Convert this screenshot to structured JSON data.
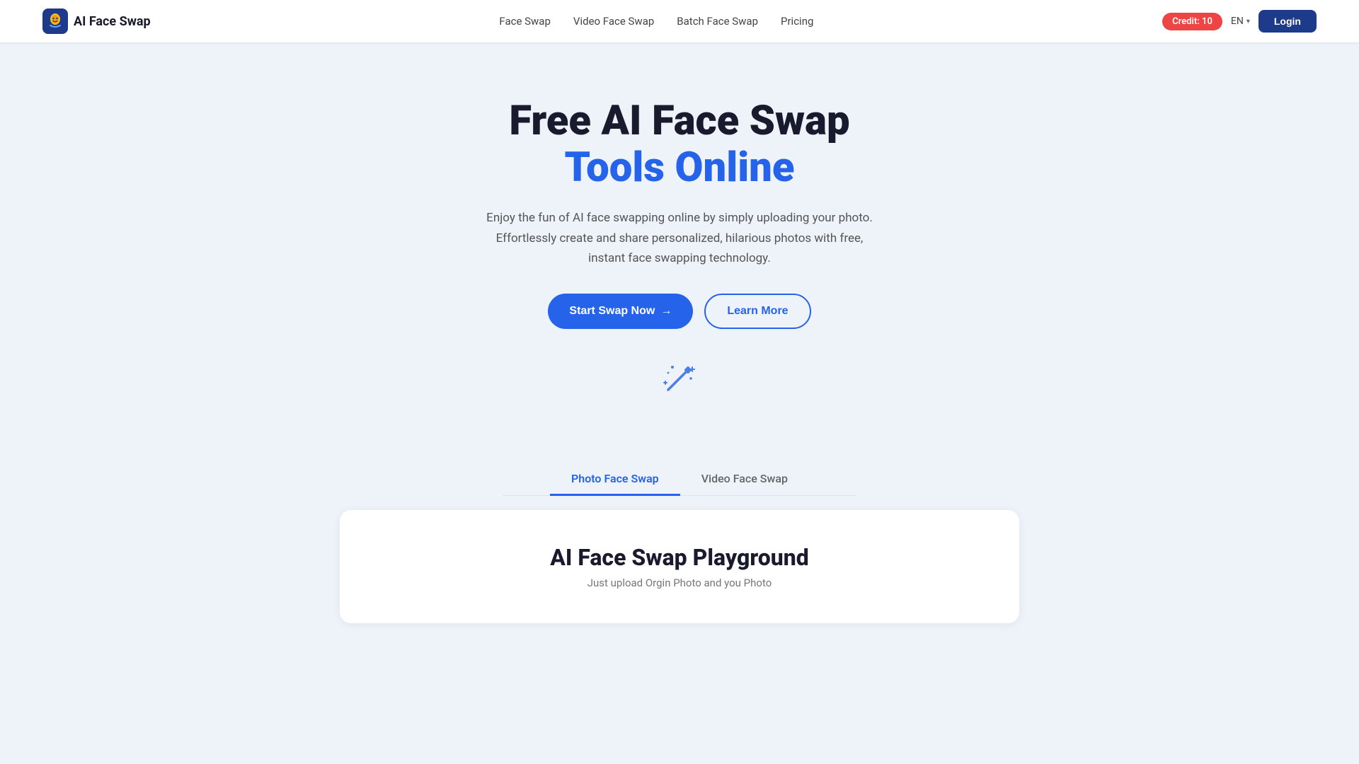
{
  "nav": {
    "logo_text": "AI Face Swap",
    "links": [
      {
        "label": "Face Swap",
        "id": "face-swap"
      },
      {
        "label": "Video Face Swap",
        "id": "video-face-swap"
      },
      {
        "label": "Batch Face Swap",
        "id": "batch-face-swap"
      },
      {
        "label": "Pricing",
        "id": "pricing"
      }
    ],
    "credit_label": "Credit: 10",
    "lang_label": "EN",
    "login_label": "Login"
  },
  "hero": {
    "title_line1": "Free AI Face Swap",
    "title_line2": "Tools Online",
    "subtitle": "Enjoy the fun of AI face swapping online by simply uploading your photo. Effortlessly create and share personalized, hilarious photos with free, instant face swapping technology.",
    "cta_primary": "Start Swap Now",
    "cta_secondary": "Learn More"
  },
  "tabs": [
    {
      "label": "Photo Face Swap",
      "active": true
    },
    {
      "label": "Video Face Swap",
      "active": false
    }
  ],
  "playground": {
    "title": "AI Face Swap Playground",
    "subtitle": "Just upload Orgin Photo and you Photo"
  }
}
